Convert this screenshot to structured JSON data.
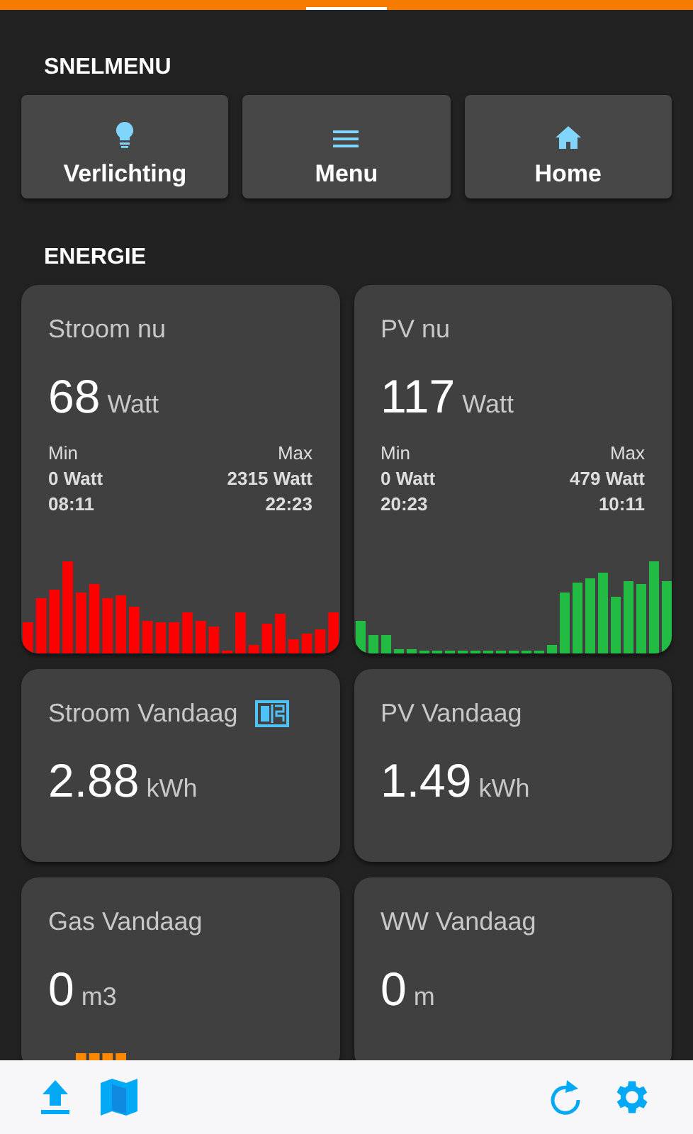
{
  "quick_menu": {
    "title": "SNELMENU",
    "buttons": [
      {
        "label": "Verlichting",
        "kind": "bulb"
      },
      {
        "label": "Menu",
        "kind": "menu"
      },
      {
        "label": "Home",
        "kind": "home"
      }
    ]
  },
  "energy": {
    "title": "ENERGIE",
    "cards": [
      {
        "title": "Stroom nu",
        "value": "68",
        "unit": "Watt",
        "stats": {
          "min_label": "Min",
          "min_value": "0 Watt",
          "min_time": "08:11",
          "max_label": "Max",
          "max_value": "2315 Watt",
          "max_time": "22:23"
        },
        "color": "#ff0000",
        "kind": "sparkline"
      },
      {
        "title": "PV nu",
        "value": "117",
        "unit": "Watt",
        "stats": {
          "min_label": "Min",
          "min_value": "0 Watt",
          "min_time": "20:23",
          "max_label": "Max",
          "max_value": "479 Watt",
          "max_time": "10:11"
        },
        "color": "#22bb44",
        "kind": "sparkline"
      },
      {
        "title": "Stroom Vandaag",
        "value": "2.88",
        "unit": "kWh",
        "tariff_icon": true,
        "kind": "plain"
      },
      {
        "title": "PV Vandaag",
        "value": "1.49",
        "unit": "kWh",
        "kind": "plain"
      },
      {
        "title": "Gas Vandaag",
        "value": "0",
        "unit": "m3",
        "color": "#ff8800",
        "kind": "sparkline"
      },
      {
        "title": "WW Vandaag",
        "value": "0",
        "unit": "m",
        "kind": "plain"
      }
    ]
  },
  "bottom_bar": {
    "left": [
      {
        "kind": "upload"
      },
      {
        "kind": "map"
      }
    ],
    "right": [
      {
        "kind": "refresh"
      },
      {
        "kind": "settings"
      }
    ]
  }
}
